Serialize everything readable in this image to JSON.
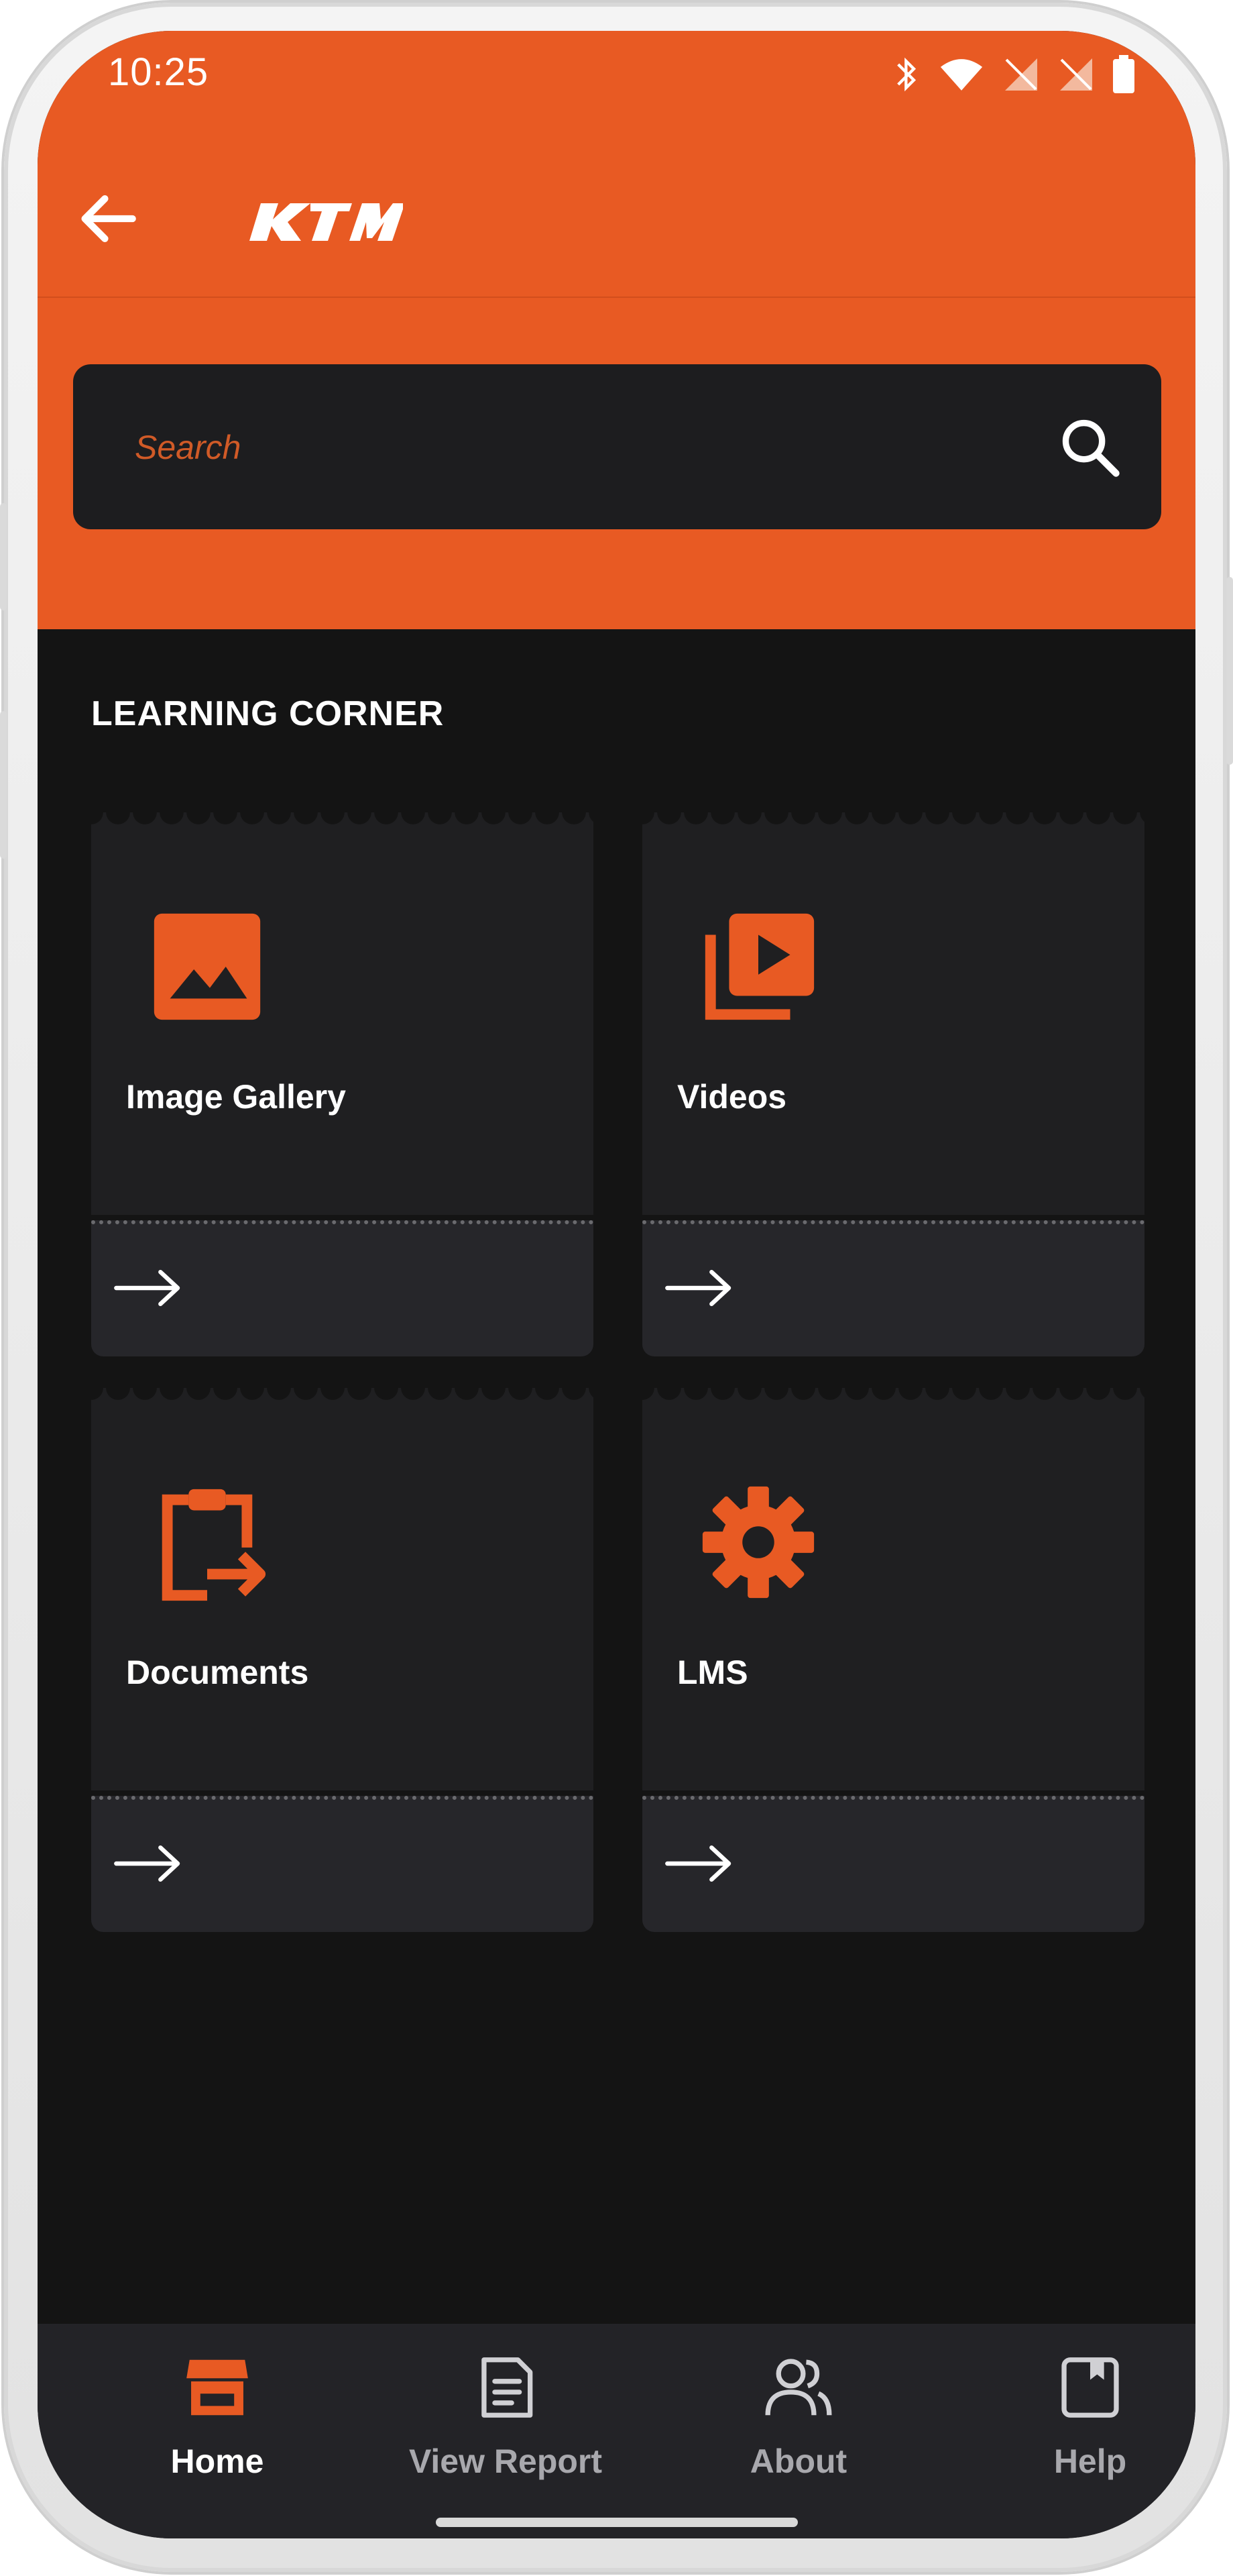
{
  "status_bar": {
    "time": "10:25",
    "icons": [
      "bluetooth-icon",
      "wifi-icon",
      "signal-icon",
      "signal-icon",
      "battery-icon"
    ]
  },
  "app_bar": {
    "logo_text": "KTM",
    "back_icon": "arrow-left-icon"
  },
  "search": {
    "placeholder": "Search",
    "icon": "search-icon"
  },
  "section": {
    "title": "LEARNING CORNER"
  },
  "cards": [
    {
      "label": "Image Gallery",
      "icon": "image-icon"
    },
    {
      "label": "Videos",
      "icon": "video-library-icon"
    },
    {
      "label": "Documents",
      "icon": "clipboard-export-icon"
    },
    {
      "label": "LMS",
      "icon": "gear-icon"
    }
  ],
  "bottom_nav": {
    "items": [
      {
        "label": "Home",
        "icon": "store-icon",
        "active": true
      },
      {
        "label": "View Report",
        "icon": "report-icon",
        "active": false
      },
      {
        "label": "About",
        "icon": "users-icon",
        "active": false
      },
      {
        "label": "Help",
        "icon": "bookmark-book-icon",
        "active": false
      }
    ]
  },
  "colors": {
    "brand_orange": "#e85a23",
    "background": "#141414",
    "card": "#1f1f21",
    "nav_bg": "#232327"
  }
}
